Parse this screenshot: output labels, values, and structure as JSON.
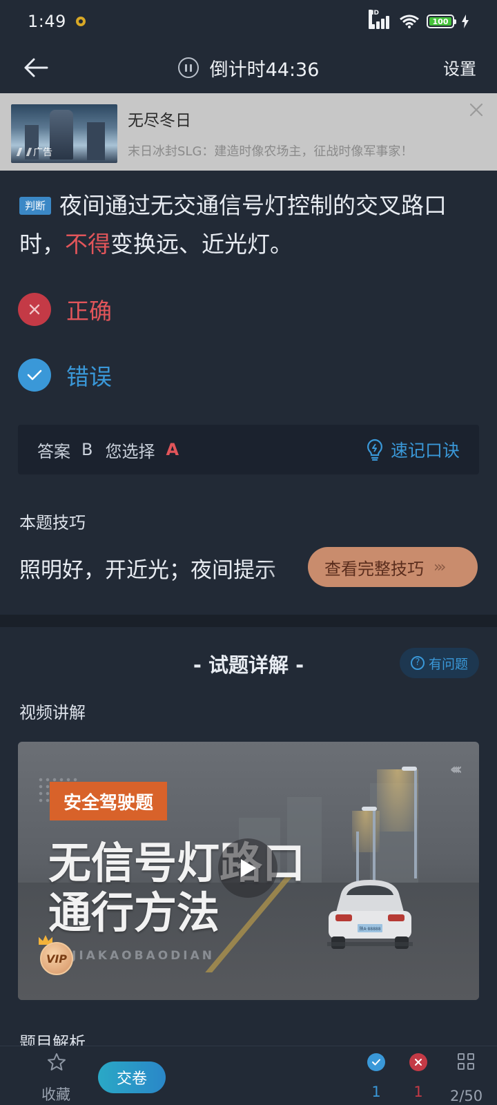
{
  "status_bar": {
    "time": "1:49",
    "network": "HD",
    "signal_sub": "4G",
    "battery": "100"
  },
  "nav": {
    "back_icon": "back-arrow-icon",
    "timer_label": "倒计时44:36",
    "settings_label": "设置"
  },
  "ad": {
    "title": "无尽冬日",
    "description": "末日冰封SLG：建造时像农场主，征战时像军事家！",
    "tag": "广告"
  },
  "question": {
    "type_badge": "判断",
    "text_before": "夜间通过无交通信号灯控制的交叉路口时，",
    "text_highlight": "不得",
    "text_after": "变换远、近光灯。",
    "options": [
      {
        "label": "正确",
        "state": "wrong",
        "color": "#e2555a"
      },
      {
        "label": "错误",
        "state": "correct",
        "color": "#3a98d8"
      }
    ]
  },
  "answer": {
    "answer_label": "答案",
    "answer_value": "B",
    "selected_label": "您选择",
    "selected_value": "A",
    "mnemonic_label": "速记口诀"
  },
  "tip": {
    "title": "本题技巧",
    "text": "照明好，开近光；夜间提示",
    "button_label": "查看完整技巧"
  },
  "explanation": {
    "title": "- 试题详解 -",
    "question_button": "有问题",
    "video_title": "视频讲解",
    "video": {
      "tag": "安全驾驶题",
      "headline_1": "无信号灯路口",
      "headline_2": "通行方法",
      "brand": "JIAKAOBAODIAN",
      "vip": "VIP",
      "plate": "陕A·88888"
    },
    "analysis_title": "题目解析"
  },
  "bottom_bar": {
    "favorite_label": "收藏",
    "submit_label": "交卷",
    "correct_count": "1",
    "wrong_count": "1",
    "progress": "2/50"
  },
  "colors": {
    "background": "#222a36",
    "accent_blue": "#3a98d8",
    "accent_red": "#e2555a",
    "tip_button": "#c98c6d"
  }
}
